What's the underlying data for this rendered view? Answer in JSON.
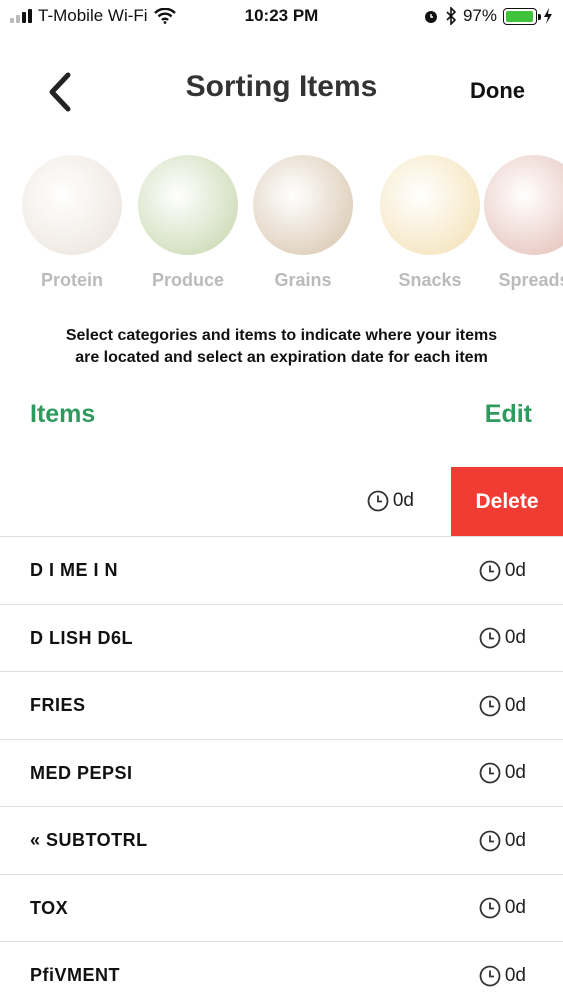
{
  "status_bar": {
    "carrier": "T-Mobile Wi-Fi",
    "time": "10:23 PM",
    "battery": "97%",
    "battery_level": 0.97
  },
  "nav": {
    "title": "Sorting Items",
    "done_label": "Done"
  },
  "categories": [
    {
      "label": "Protein",
      "color": "#d9c8b8"
    },
    {
      "label": "Produce",
      "color": "#8fae5c"
    },
    {
      "label": "Grains",
      "color": "#b08a5a"
    },
    {
      "label": "Snacks",
      "color": "#e9c46a"
    },
    {
      "label": "Spreads",
      "color": "#c97b6a"
    }
  ],
  "instructions": "Select categories and items to indicate where your items are located and select an expiration date for each item",
  "section": {
    "title": "Items",
    "edit_label": "Edit"
  },
  "swiped_row": {
    "expiration": "0d",
    "delete_label": "Delete"
  },
  "items": [
    {
      "name": "D I ME I N",
      "expiration": "0d"
    },
    {
      "name": "D LISH D6L",
      "expiration": "0d"
    },
    {
      "name": "FRIES",
      "expiration": "0d"
    },
    {
      "name": "MED PEPSI",
      "expiration": "0d"
    },
    {
      "name": "« SUBTOTRL",
      "expiration": "0d"
    },
    {
      "name": "TOX",
      "expiration": "0d"
    },
    {
      "name": "PfiVMENT",
      "expiration": "0d"
    }
  ],
  "colors": {
    "accent": "#2f9a5e",
    "delete": "#f03c32"
  }
}
